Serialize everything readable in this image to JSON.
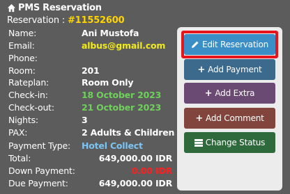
{
  "header": {
    "title": "PMS Reservation",
    "reservation_label": "Reservation : ",
    "reservation_id": "#11552600"
  },
  "details": {
    "name_label": "Name:",
    "name_value": "Ani Mustofa",
    "email_label": "Email:",
    "email_value": "albus@gmail.com",
    "phone_label": "Phone:",
    "phone_value": "",
    "room_label": "Room:",
    "room_value": "201",
    "rateplan_label": "Rateplan:",
    "rateplan_value": "Room Only",
    "checkin_label": "Check-in:",
    "checkin_value": "18 October 2023",
    "checkout_label": "Check-out:",
    "checkout_value": "21 October 2023",
    "nights_label": "Nights:",
    "nights_value": "3",
    "pax_label": "PAX:",
    "pax_value": "2 Adults & Children",
    "payment_type_label": "Payment Type:",
    "payment_type_value": "Hotel Collect",
    "total_label": "Total:",
    "total_value": "649,000.00 IDR",
    "down_payment_label": "Down Payment:",
    "down_payment_value": "0.00 IDR",
    "due_payment_label": "Due Payment:",
    "due_payment_value": "649,000.00 IDR"
  },
  "actions": {
    "edit_label": "Edit Reservation",
    "add_payment_label": "Add Payment",
    "add_extra_label": "Add Extra",
    "add_comment_label": "Add Comment",
    "change_status_label": "Change Status"
  },
  "colors": {
    "background": "#5c5c5c",
    "reservation_id": "#ffd400",
    "email": "#f2ea1c",
    "checkin": "#6fd05b",
    "payment_type": "#7ec4f2",
    "down_payment": "#ff1f1f",
    "highlight": "#e8141b"
  }
}
